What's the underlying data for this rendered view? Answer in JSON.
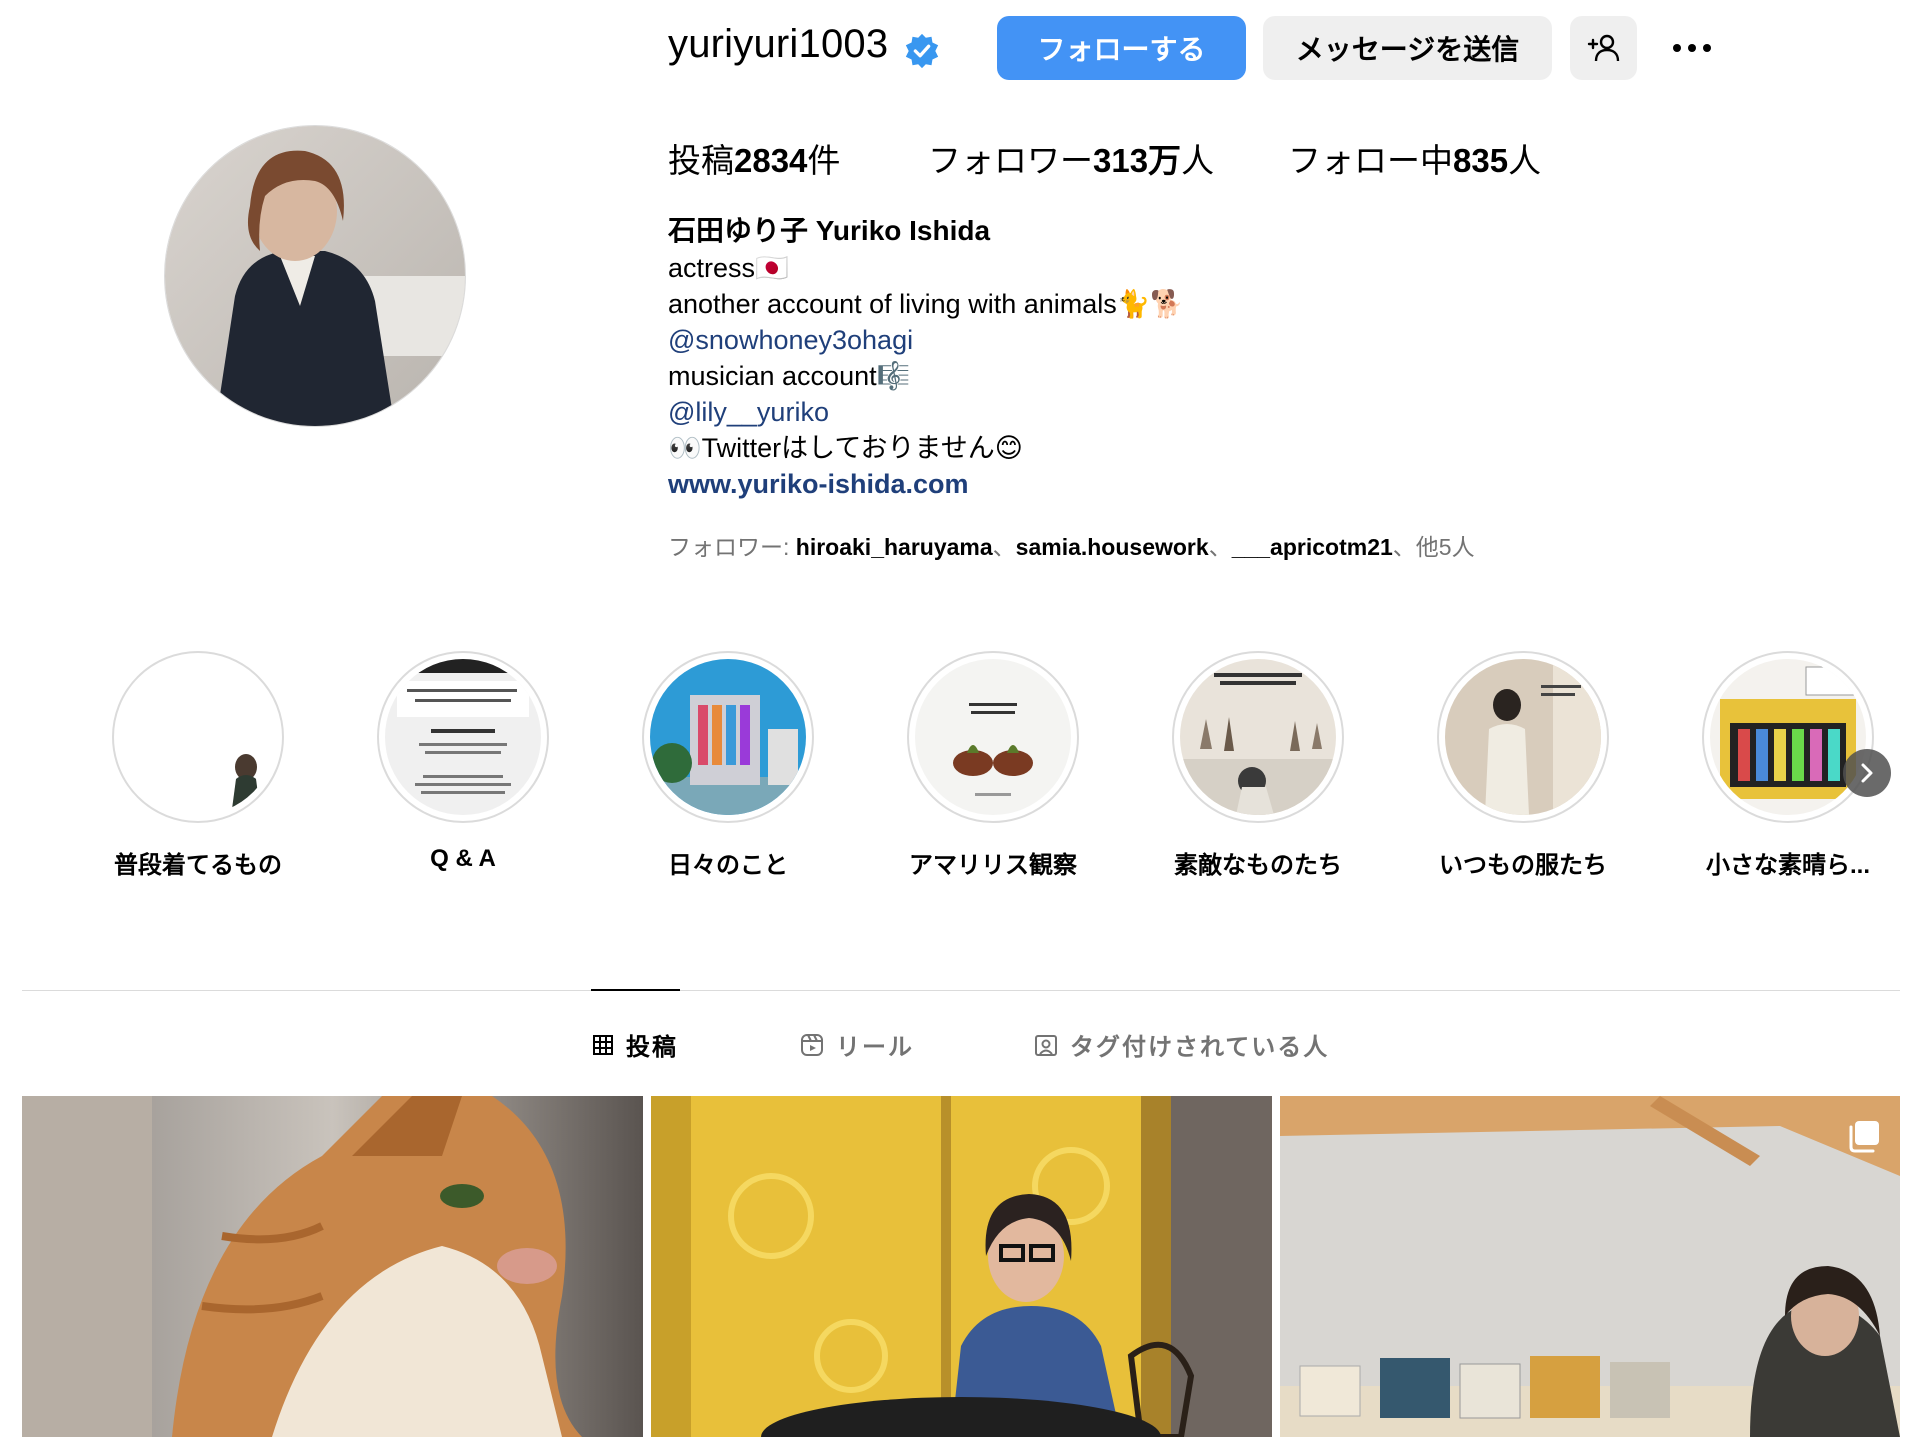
{
  "profile": {
    "username": "yuriyuri1003",
    "verified": true,
    "follow_label": "フォローする",
    "message_label": "メッセージを送信",
    "add_user_icon": "add-user-icon",
    "more_icon": "more-options-icon"
  },
  "stats": {
    "posts_prefix": "投稿",
    "posts_count": "2834",
    "posts_suffix": "件",
    "followers_prefix": "フォロワー",
    "followers_count": "313万",
    "followers_suffix": "人",
    "following_prefix": "フォロー中",
    "following_count": "835",
    "following_suffix": "人"
  },
  "bio": {
    "name": "石田ゆり子 Yuriko Ishida",
    "line1": "actress🇯🇵",
    "line2": "another account of living with animals🐈🐕",
    "line3": "@snowhoney3ohagi",
    "line4": "musician account🎼",
    "line5": "@lily__yuriko",
    "line6": "👀Twitterはしておりません😊",
    "url": "www.yuriko-ishida.com"
  },
  "followed_by": {
    "prefix": "フォロワー: ",
    "names": [
      "hiroaki_haruyama",
      "samia.housework",
      "___apricotm21"
    ],
    "sep": "、",
    "suffix": "、他5人"
  },
  "highlights": [
    {
      "label": "普段着てるもの"
    },
    {
      "label": "Q & A"
    },
    {
      "label": "日々のこと"
    },
    {
      "label": "アマリリス観察"
    },
    {
      "label": "素敵なものたち"
    },
    {
      "label": "いつもの服たち"
    },
    {
      "label": "小さな素晴ら..."
    }
  ],
  "tabs": {
    "posts": "投稿",
    "reels": "リール",
    "tagged": "タグ付けされている人"
  },
  "colors": {
    "accent_blue": "#4393f5",
    "link_blue": "#1f3f7a",
    "button_grey": "#efefef",
    "muted_text": "#737373"
  }
}
